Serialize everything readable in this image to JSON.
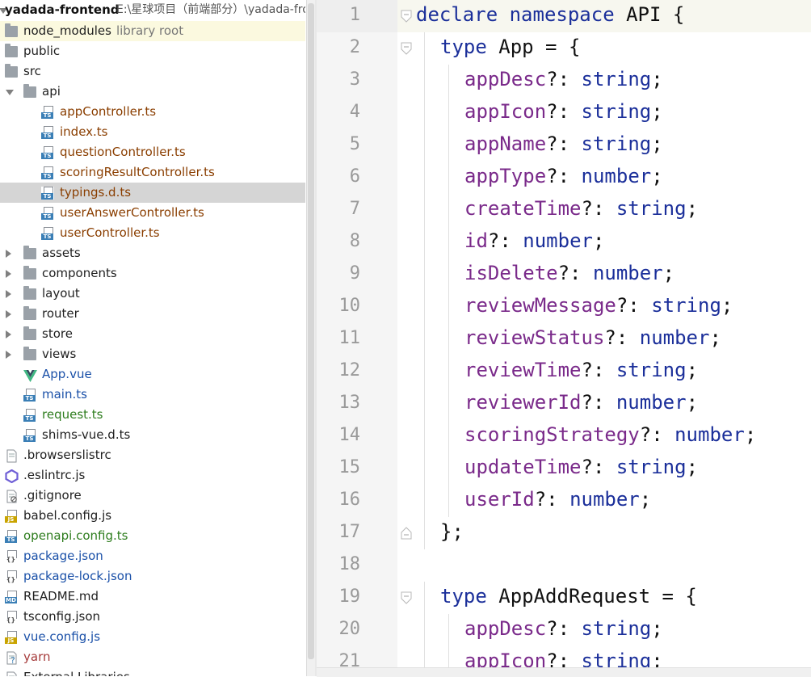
{
  "project": {
    "root_name": "yadada-frontend",
    "root_path": "E:\\星球项目（前端部分）\\yadada-fro",
    "items": [
      {
        "label": "node_modules",
        "extra": "library root",
        "kind": "folder",
        "arrow": "",
        "depth": 0,
        "style": "",
        "highlight": "yellow"
      },
      {
        "label": "public",
        "kind": "folder",
        "arrow": "",
        "depth": 0,
        "style": ""
      },
      {
        "label": "src",
        "kind": "folder",
        "arrow": "",
        "depth": 0,
        "style": ""
      },
      {
        "label": "api",
        "kind": "folder",
        "arrow": "down",
        "depth": 1,
        "style": ""
      },
      {
        "label": "appController.ts",
        "kind": "ts",
        "arrow": "",
        "depth": 2,
        "style": "mod"
      },
      {
        "label": "index.ts",
        "kind": "ts",
        "arrow": "",
        "depth": 2,
        "style": "mod"
      },
      {
        "label": "questionController.ts",
        "kind": "ts",
        "arrow": "",
        "depth": 2,
        "style": "mod"
      },
      {
        "label": "scoringResultController.ts",
        "kind": "ts",
        "arrow": "",
        "depth": 2,
        "style": "mod"
      },
      {
        "label": "typings.d.ts",
        "kind": "ts",
        "arrow": "",
        "depth": 2,
        "style": "mod",
        "highlight": "grey"
      },
      {
        "label": "userAnswerController.ts",
        "kind": "ts",
        "arrow": "",
        "depth": 2,
        "style": "mod"
      },
      {
        "label": "userController.ts",
        "kind": "ts",
        "arrow": "",
        "depth": 2,
        "style": "mod"
      },
      {
        "label": "assets",
        "kind": "folder",
        "arrow": "right",
        "depth": 1,
        "style": ""
      },
      {
        "label": "components",
        "kind": "folder",
        "arrow": "right",
        "depth": 1,
        "style": ""
      },
      {
        "label": "layout",
        "kind": "folder",
        "arrow": "right",
        "depth": 1,
        "style": ""
      },
      {
        "label": "router",
        "kind": "folder",
        "arrow": "right",
        "depth": 1,
        "style": ""
      },
      {
        "label": "store",
        "kind": "folder",
        "arrow": "right",
        "depth": 1,
        "style": ""
      },
      {
        "label": "views",
        "kind": "folder",
        "arrow": "right",
        "depth": 1,
        "style": ""
      },
      {
        "label": "App.vue",
        "kind": "vue",
        "arrow": "",
        "depth": 1,
        "style": "blue"
      },
      {
        "label": "main.ts",
        "kind": "ts",
        "arrow": "",
        "depth": 1,
        "style": "blue"
      },
      {
        "label": "request.ts",
        "kind": "ts",
        "arrow": "",
        "depth": 1,
        "style": "green"
      },
      {
        "label": "shims-vue.d.ts",
        "kind": "ts",
        "arrow": "",
        "depth": 1,
        "style": ""
      },
      {
        "label": ".browserslistrc",
        "kind": "text",
        "arrow": "",
        "depth": 0,
        "style": ""
      },
      {
        "label": ".eslintrc.js",
        "kind": "eslint",
        "arrow": "",
        "depth": 0,
        "style": ""
      },
      {
        "label": ".gitignore",
        "kind": "ignore",
        "arrow": "",
        "depth": 0,
        "style": ""
      },
      {
        "label": "babel.config.js",
        "kind": "js",
        "arrow": "",
        "depth": 0,
        "style": ""
      },
      {
        "label": "openapi.config.ts",
        "kind": "ts",
        "arrow": "",
        "depth": 0,
        "style": "green"
      },
      {
        "label": "package.json",
        "kind": "json",
        "arrow": "",
        "depth": 0,
        "style": "blue"
      },
      {
        "label": "package-lock.json",
        "kind": "json",
        "arrow": "",
        "depth": 0,
        "style": "blue"
      },
      {
        "label": "README.md",
        "kind": "md",
        "arrow": "",
        "depth": 0,
        "style": ""
      },
      {
        "label": "tsconfig.json",
        "kind": "json",
        "arrow": "",
        "depth": 0,
        "style": ""
      },
      {
        "label": "vue.config.js",
        "kind": "js",
        "arrow": "",
        "depth": 0,
        "style": "blue"
      },
      {
        "label": "yarn",
        "kind": "yarn",
        "arrow": "",
        "depth": 0,
        "style": "yarn"
      },
      {
        "label": "External Libraries",
        "kind": "lib",
        "arrow": "",
        "depth": 0,
        "style": ""
      }
    ]
  },
  "editor": {
    "current_line": 1,
    "lines": [
      {
        "n": "1",
        "fold": "open",
        "tokens": [
          [
            "kw",
            "declare"
          ],
          [
            "plain",
            " "
          ],
          [
            "kw",
            "namespace"
          ],
          [
            "plain",
            " API {"
          ]
        ]
      },
      {
        "n": "2",
        "fold": "open",
        "indent": 1,
        "tokens": [
          [
            "kw",
            "type"
          ],
          [
            "plain",
            " App = {"
          ]
        ]
      },
      {
        "n": "3",
        "indent": 2,
        "tokens": [
          [
            "prop",
            "appDesc"
          ],
          [
            "plain",
            "?: "
          ],
          [
            "type",
            "string"
          ],
          [
            "plain",
            ";"
          ]
        ]
      },
      {
        "n": "4",
        "indent": 2,
        "tokens": [
          [
            "prop",
            "appIcon"
          ],
          [
            "plain",
            "?: "
          ],
          [
            "type",
            "string"
          ],
          [
            "plain",
            ";"
          ]
        ]
      },
      {
        "n": "5",
        "indent": 2,
        "tokens": [
          [
            "prop",
            "appName"
          ],
          [
            "plain",
            "?: "
          ],
          [
            "type",
            "string"
          ],
          [
            "plain",
            ";"
          ]
        ]
      },
      {
        "n": "6",
        "indent": 2,
        "tokens": [
          [
            "prop",
            "appType"
          ],
          [
            "plain",
            "?: "
          ],
          [
            "type",
            "number"
          ],
          [
            "plain",
            ";"
          ]
        ]
      },
      {
        "n": "7",
        "indent": 2,
        "tokens": [
          [
            "prop",
            "createTime"
          ],
          [
            "plain",
            "?: "
          ],
          [
            "type",
            "string"
          ],
          [
            "plain",
            ";"
          ]
        ]
      },
      {
        "n": "8",
        "indent": 2,
        "tokens": [
          [
            "prop",
            "id"
          ],
          [
            "plain",
            "?: "
          ],
          [
            "type",
            "number"
          ],
          [
            "plain",
            ";"
          ]
        ]
      },
      {
        "n": "9",
        "indent": 2,
        "tokens": [
          [
            "prop",
            "isDelete"
          ],
          [
            "plain",
            "?: "
          ],
          [
            "type",
            "number"
          ],
          [
            "plain",
            ";"
          ]
        ]
      },
      {
        "n": "10",
        "indent": 2,
        "tokens": [
          [
            "prop",
            "reviewMessage"
          ],
          [
            "plain",
            "?: "
          ],
          [
            "type",
            "string"
          ],
          [
            "plain",
            ";"
          ]
        ]
      },
      {
        "n": "11",
        "indent": 2,
        "tokens": [
          [
            "prop",
            "reviewStatus"
          ],
          [
            "plain",
            "?: "
          ],
          [
            "type",
            "number"
          ],
          [
            "plain",
            ";"
          ]
        ]
      },
      {
        "n": "12",
        "indent": 2,
        "tokens": [
          [
            "prop",
            "reviewTime"
          ],
          [
            "plain",
            "?: "
          ],
          [
            "type",
            "string"
          ],
          [
            "plain",
            ";"
          ]
        ]
      },
      {
        "n": "13",
        "indent": 2,
        "tokens": [
          [
            "prop",
            "reviewerId"
          ],
          [
            "plain",
            "?: "
          ],
          [
            "type",
            "number"
          ],
          [
            "plain",
            ";"
          ]
        ]
      },
      {
        "n": "14",
        "indent": 2,
        "tokens": [
          [
            "prop",
            "scoringStrategy"
          ],
          [
            "plain",
            "?: "
          ],
          [
            "type",
            "number"
          ],
          [
            "plain",
            ";"
          ]
        ]
      },
      {
        "n": "15",
        "indent": 2,
        "tokens": [
          [
            "prop",
            "updateTime"
          ],
          [
            "plain",
            "?: "
          ],
          [
            "type",
            "string"
          ],
          [
            "plain",
            ";"
          ]
        ]
      },
      {
        "n": "16",
        "indent": 2,
        "tokens": [
          [
            "prop",
            "userId"
          ],
          [
            "plain",
            "?: "
          ],
          [
            "type",
            "number"
          ],
          [
            "plain",
            ";"
          ]
        ]
      },
      {
        "n": "17",
        "fold": "close",
        "indent": 1,
        "tokens": [
          [
            "plain",
            "};"
          ]
        ]
      },
      {
        "n": "18",
        "tokens": []
      },
      {
        "n": "19",
        "fold": "open",
        "indent": 1,
        "tokens": [
          [
            "kw",
            "type"
          ],
          [
            "plain",
            " AppAddRequest = {"
          ]
        ]
      },
      {
        "n": "20",
        "indent": 2,
        "tokens": [
          [
            "prop",
            "appDesc"
          ],
          [
            "plain",
            "?: "
          ],
          [
            "type",
            "string"
          ],
          [
            "plain",
            ";"
          ]
        ]
      },
      {
        "n": "21",
        "indent": 2,
        "tokens": [
          [
            "prop",
            "appIcon"
          ],
          [
            "plain",
            "?: "
          ],
          [
            "type",
            "string"
          ],
          [
            "plain",
            ";"
          ]
        ]
      }
    ]
  },
  "colors": {
    "keyword": "#1b2f9a",
    "property": "#7a2a8a",
    "modified_file": "#8a3e00",
    "changed_file": "#1a50a8",
    "added_file": "#2e7d1e"
  }
}
